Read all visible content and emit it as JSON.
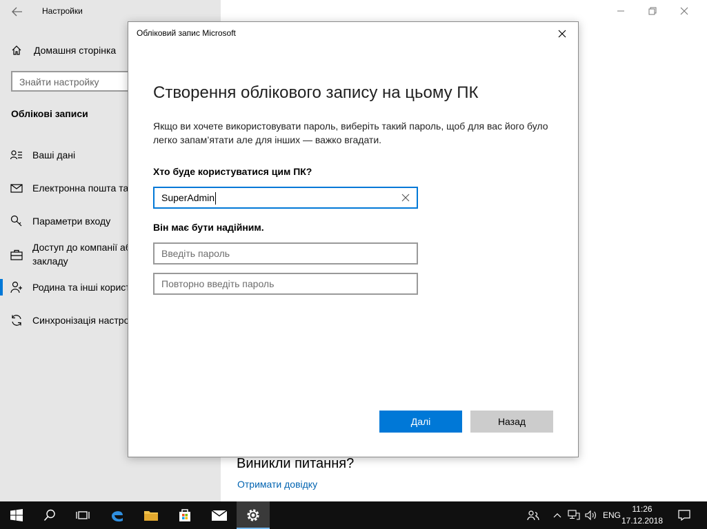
{
  "settings_window": {
    "title": "Настройки",
    "home_label": "Домашня сторінка",
    "search_placeholder": "Знайти настройку",
    "section_title": "Облікові записи",
    "nav": [
      {
        "label": "Ваші дані",
        "icon": "user-info-icon"
      },
      {
        "label": "Електронна пошта та",
        "icon": "mail-icon"
      },
      {
        "label": "Параметри входу",
        "icon": "key-icon"
      },
      {
        "label": "Доступ до компанії аб",
        "label2": "закладу",
        "icon": "briefcase-icon"
      },
      {
        "label": "Родина та інші корист",
        "icon": "family-icon",
        "active": true
      },
      {
        "label": "Синхронізація настро",
        "icon": "sync-icon"
      }
    ],
    "questions_heading": "Виникли питання?",
    "help_link": "Отримати довідку"
  },
  "dialog": {
    "title": "Обліковий запис Microsoft",
    "heading": "Створення облікового запису на цьому ПК",
    "description": "Якщо ви хочете використовувати пароль, виберіть такий пароль, щоб для вас його було легко запам’ятати але для інших — важко вгадати.",
    "username_label": "Хто буде користуватися цим ПК?",
    "username_value": "SuperAdmin",
    "password_label": "Він має бути надійним.",
    "password_placeholder": "Введіть пароль",
    "password_repeat_placeholder": "Повторно введіть пароль",
    "next_button": "Далі",
    "back_button": "Назад"
  },
  "taskbar": {
    "language": "ENG",
    "time": "11:26",
    "date": "17.12.2018"
  },
  "colors": {
    "accent": "#0078d7",
    "sidebar_bg": "#e6e6e6",
    "taskbar_bg": "#101010",
    "link": "#0063b1"
  }
}
